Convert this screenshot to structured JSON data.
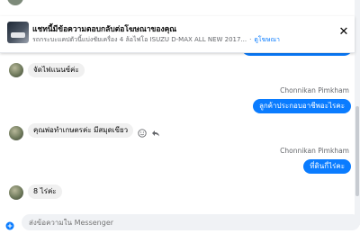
{
  "notice": {
    "title": "แชทนี้มีข้อความตอบกลับต่อโฆษณาของคุณ",
    "subtitle": "รถกระบะแคปตัวนี้แบ่งชัยเครื่อง 4 ล้อไฟโอ ISUZU D-MAX ALL NEW 2017...",
    "link": "ดูโฆษณา"
  },
  "messages": [
    {
      "text": "จัดไฟแนนซ์ค่ะ"
    },
    {
      "sender": "Chonnikan Pimkham",
      "text": "ลูกค้าประกอบอาชีพอะไรคะ"
    },
    {
      "text": "คุณพ่อทำเกษตรค่ะ มีสมุดเขียว"
    },
    {
      "sender": "Chonnikan Pimkham",
      "text": "ที่ดินกี่ไร่คะ"
    },
    {
      "text": "8 ไร่ค่ะ"
    }
  ],
  "composer": {
    "placeholder": "ส่งข้อความใน Messenger"
  },
  "colors": {
    "accent": "#0a7cff",
    "incoming_bubble": "#f0f0f0"
  },
  "icons": [
    "close-icon",
    "emoji-icon",
    "reply-icon",
    "plus-icon"
  ]
}
